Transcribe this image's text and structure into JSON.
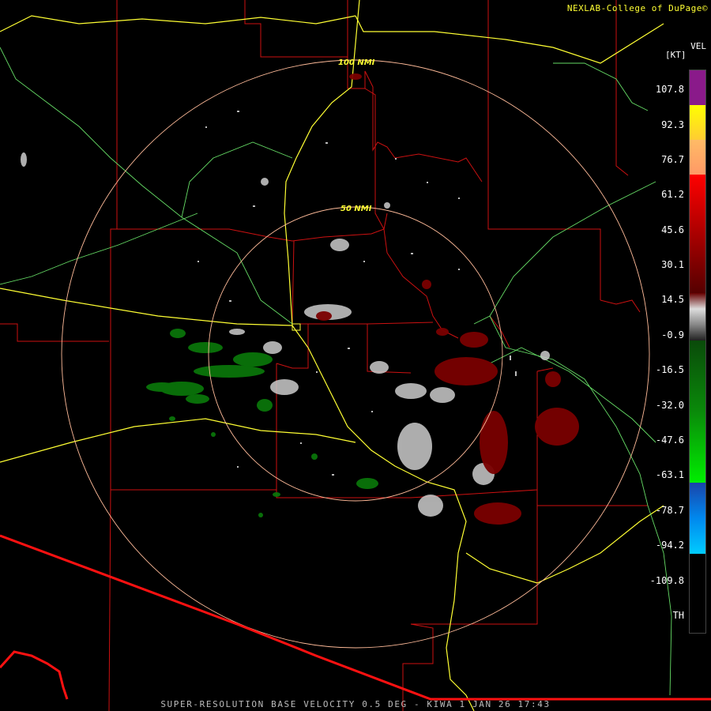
{
  "header": {
    "credit": "NEXLAB-College of DuPage"
  },
  "legend": {
    "unit_top": "VEL",
    "unit_sub": "[KT]",
    "ticks": [
      "107.8",
      "92.3",
      "76.7",
      "61.2",
      "45.6",
      "30.1",
      "14.5",
      "-0.9",
      "-16.5",
      "-32.0",
      "-47.6",
      "-63.1",
      "-78.7",
      "-94.2",
      "-109.8",
      "TH"
    ],
    "colors": {
      "purple": "#8a1a8a",
      "yellow": "#ffff00",
      "orange": "#ffaa66",
      "red": "#ff0000",
      "dark_red": "#800000",
      "gray": "#b0b0b0",
      "dark_green": "#0a5a0a",
      "green": "#00cc00",
      "blue": "#1a66cc",
      "cyan": "#00aaff",
      "black": "#000000"
    }
  },
  "range_rings": {
    "inner_label": "50 NMI",
    "outer_label": "100 NMI"
  },
  "footer": {
    "caption": "SUPER-RESOLUTION BASE VELOCITY 0.5 DEG - KIWA 1 JAN 26 17:43"
  },
  "map_colors": {
    "county_lines": "#cc1111",
    "highways": "#ffff33",
    "state_routes": "#66dd66",
    "range_rings": "#ffbb99",
    "border": "#ff0000"
  }
}
